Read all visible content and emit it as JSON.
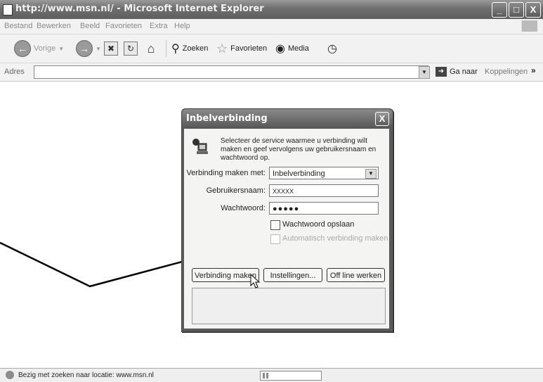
{
  "window": {
    "title": "http://www.msn.nl/ - Microsoft Internet Explorer",
    "minimize": "_",
    "maximize": "□",
    "close": "X"
  },
  "menu": [
    "Bestand",
    "Bewerken",
    "Beeld",
    "Favorieten",
    "Extra",
    "Help"
  ],
  "toolbar": {
    "back_label": "Vorige",
    "search_label": "Zoeken",
    "favorites_label": "Favorieten",
    "media_label": "Media"
  },
  "address_bar": {
    "label": "Adres",
    "value": "",
    "go_label": "Ga naar",
    "links_label": "Koppelingen",
    "links_arrow": "»"
  },
  "status_bar": {
    "text": "Bezig met zoeken naar locatie: www.msn.nl",
    "progress": 0.1
  },
  "dialog": {
    "title": "Inbelverbinding",
    "close": "X",
    "description": "Selecteer de service waarmee u verbinding wilt maken en geef vervolgens uw gebruikersnaam en wachtwoord op.",
    "connect_with_label": "Verbinding maken met:",
    "connect_with_value": "Inbelverbinding",
    "username_label": "Gebruikersnaam:",
    "username_value": "XXXXX",
    "password_label": "Wachtwoord:",
    "password_value": "●●●●●",
    "save_password_label": "Wachtwoord opslaan",
    "save_password_checked": false,
    "auto_connect_label": "Automatisch verbinding maken",
    "auto_connect_enabled": false,
    "connect_button": "Verbinding maken",
    "settings_button": "Instellingen...",
    "offline_button": "Off line werken"
  }
}
